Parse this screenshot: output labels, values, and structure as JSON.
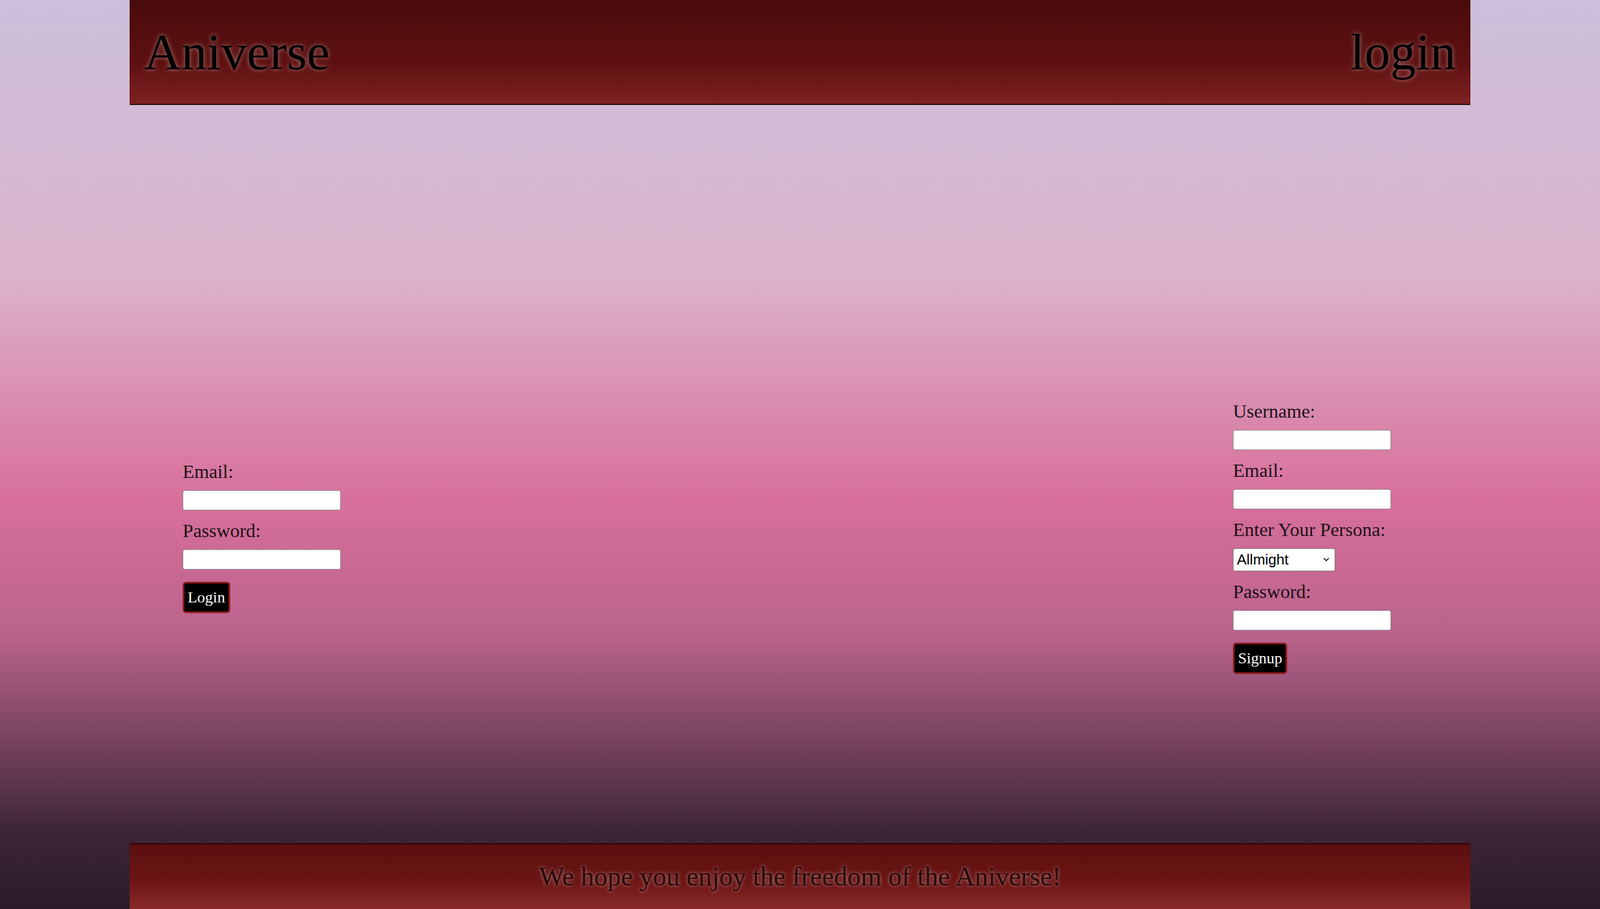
{
  "header": {
    "title": "Aniverse",
    "link": "login"
  },
  "login_form": {
    "fields": [
      {
        "label": "Email:",
        "kind": "text"
      },
      {
        "label": "Password:",
        "kind": "password"
      }
    ],
    "button": "Login"
  },
  "signup_form": {
    "fields": [
      {
        "label": "Username:",
        "kind": "text"
      },
      {
        "label": "Email:",
        "kind": "text"
      },
      {
        "label": "Enter Your Persona:",
        "kind": "select",
        "value": "Allmight"
      },
      {
        "label": "Password:",
        "kind": "password"
      }
    ],
    "button": "Signup"
  },
  "footer": {
    "text": "We hope you enjoy the freedom of the Aniverse!"
  }
}
